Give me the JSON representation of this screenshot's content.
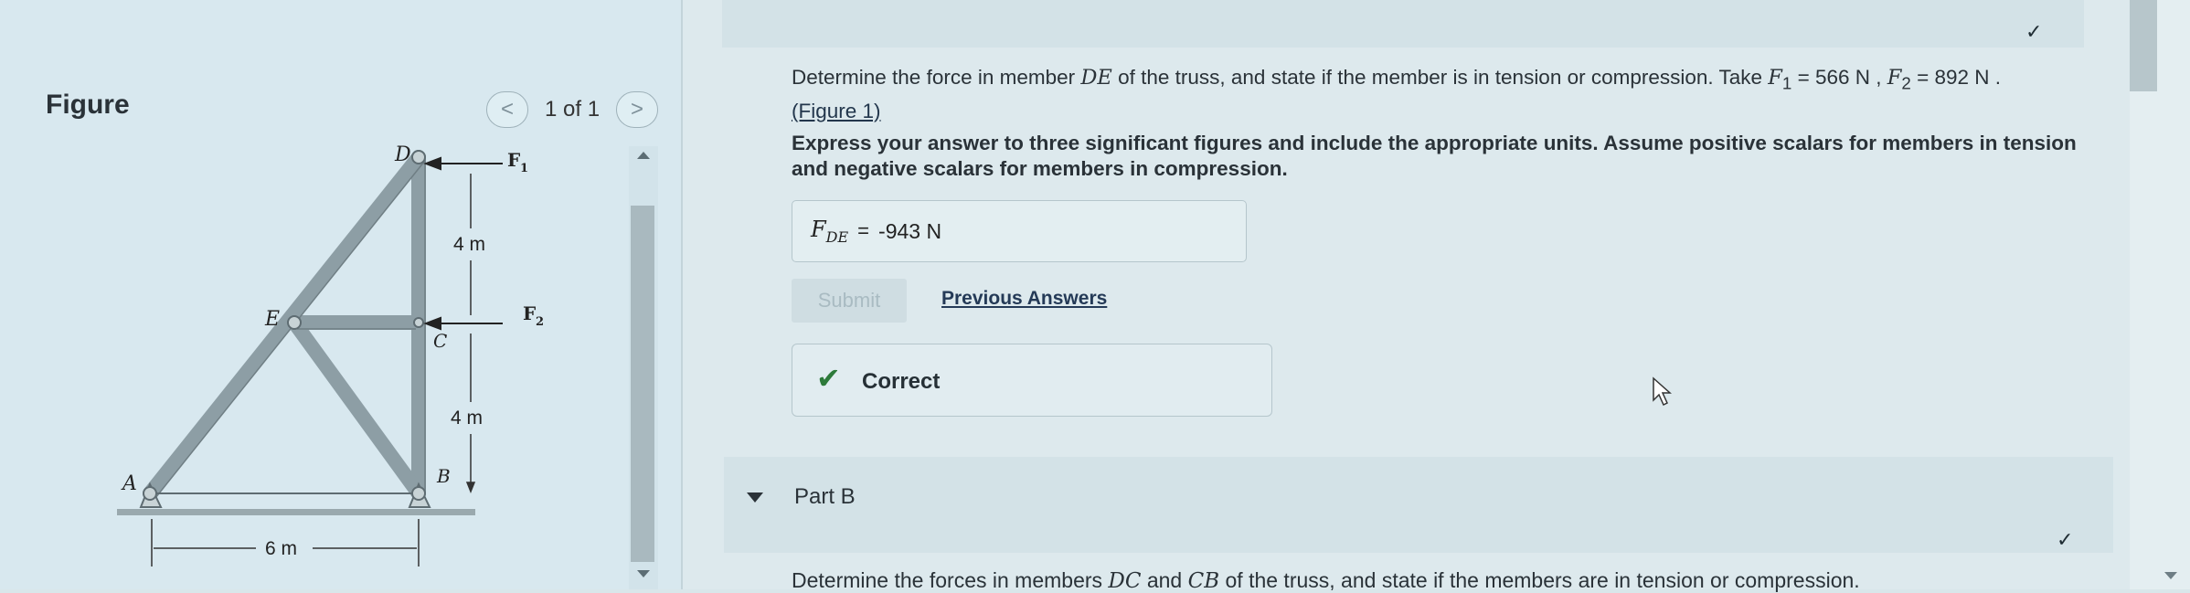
{
  "figure": {
    "title": "Figure",
    "pager": {
      "prev": "<",
      "next": ">",
      "counter": "1 of 1"
    },
    "labels": {
      "D": "D",
      "E": "E",
      "C": "C",
      "B": "B",
      "A": "A",
      "F1": "F",
      "F1_sub": "1",
      "F2": "F",
      "F2_sub": "2",
      "dim_top": "4 m",
      "dim_bottom": "4 m",
      "dim_base": "6 m"
    }
  },
  "question": {
    "text_1": "Determine the force in member ",
    "member": "DE",
    "text_2": " of the truss, and state if the member is in tension or compression. Take ",
    "f1_symbol": "F",
    "f1_sub": "1",
    "f1_value": " = 566 N",
    "sep": " , ",
    "f2_symbol": "F",
    "f2_sub": "2",
    "f2_value": " = 892 N",
    "end": " .",
    "figure_link": "(Figure 1)"
  },
  "instruction": "Express your answer to three significant figures and include the appropriate units. Assume positive scalars for members in tension and negative scalars for members in compression.",
  "answer": {
    "label": "F",
    "label_sub": "DE",
    "eq": "=",
    "value": "-943 N"
  },
  "buttons": {
    "submit": "Submit",
    "previous_answers": "Previous Answers"
  },
  "feedback": {
    "icon": "✔",
    "text": "Correct"
  },
  "part_b": {
    "title": "Part B",
    "question_1": "Determine the forces in members ",
    "m1": "DC",
    "and": " and ",
    "m2": "CB",
    "question_2": " of the truss, and state if the members are in tension or compression."
  },
  "colors": {
    "member": "#8d9ea5",
    "correct_green": "#2d7a3a",
    "link": "#243a57"
  }
}
